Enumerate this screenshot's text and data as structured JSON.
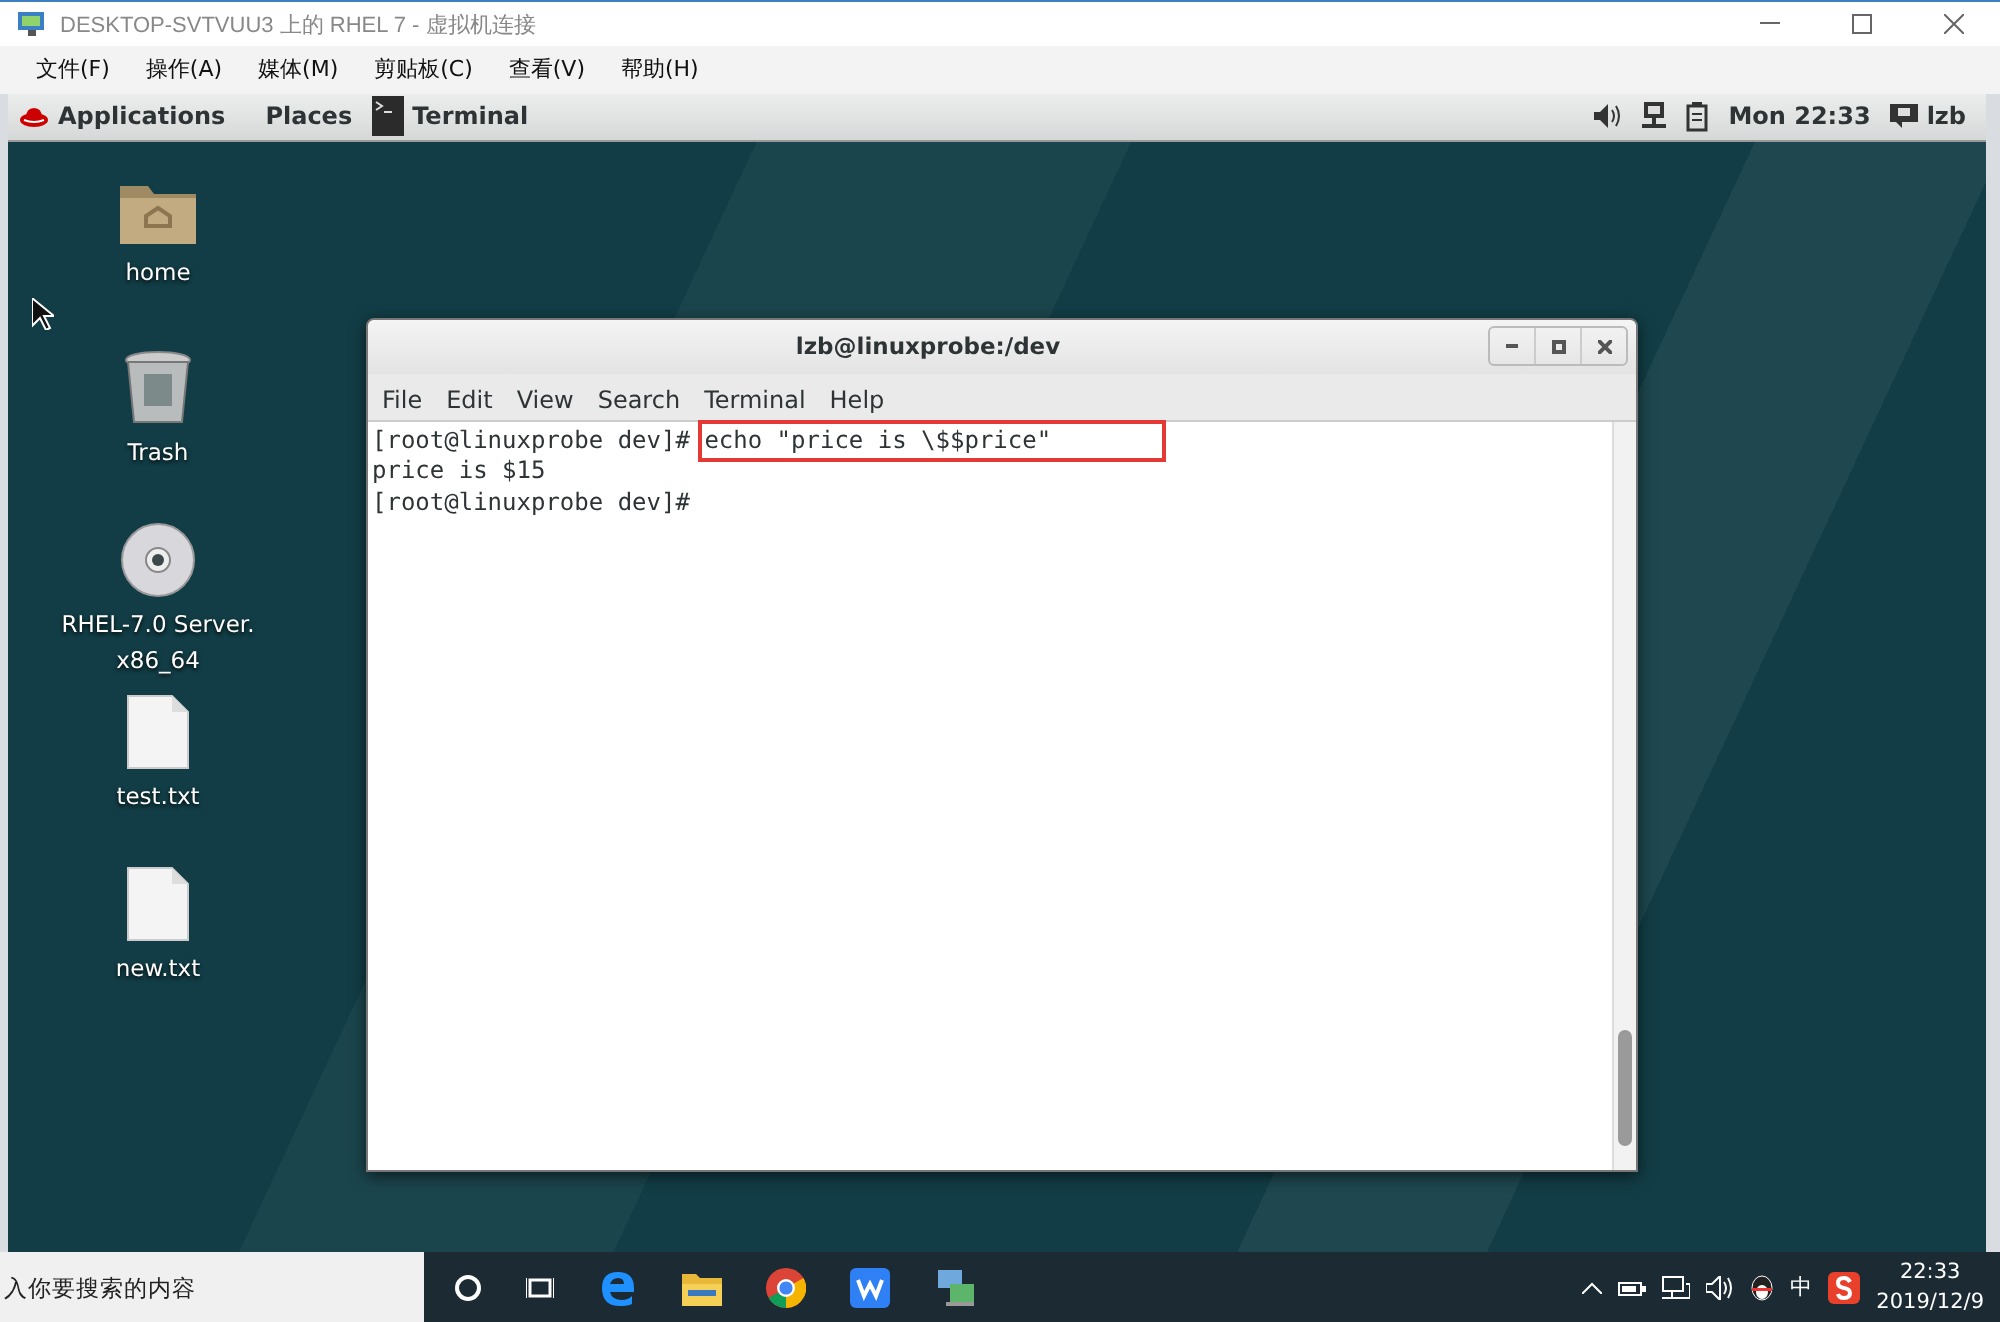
{
  "window": {
    "title": "DESKTOP-SVTVUU3 上的 RHEL 7 - 虚拟机连接"
  },
  "menu": [
    "文件(F)",
    "操作(A)",
    "媒体(M)",
    "剪贴板(C)",
    "查看(V)",
    "帮助(H)"
  ],
  "gnome_bar": {
    "applications": "Applications",
    "places": "Places",
    "task": "Terminal",
    "clock": "Mon 22:33",
    "user": "lzb"
  },
  "desktop_icons": [
    {
      "kind": "folder",
      "label": "home"
    },
    {
      "kind": "trash",
      "label": "Trash"
    },
    {
      "kind": "disc",
      "label": "RHEL-7.0 Server.\nx86_64"
    },
    {
      "kind": "file",
      "label": "test.txt"
    },
    {
      "kind": "file",
      "label": "new.txt"
    }
  ],
  "terminal": {
    "title": "lzb@linuxprobe:/dev",
    "menu": [
      "File",
      "Edit",
      "View",
      "Search",
      "Terminal",
      "Help"
    ],
    "lines": [
      {
        "kind": "prompt",
        "prompt": "[root@linuxprobe dev]#",
        "command": "echo \"price is \\$$price\"",
        "highlighted": true
      },
      {
        "kind": "output",
        "text": "price is $15"
      },
      {
        "kind": "prompt",
        "prompt": "[root@linuxprobe dev]#"
      }
    ]
  },
  "taskbar": {
    "search": {
      "placeholder": "入你要搜索的内容"
    },
    "ime": "中",
    "time": "22:33",
    "date": "2019/12/9"
  }
}
